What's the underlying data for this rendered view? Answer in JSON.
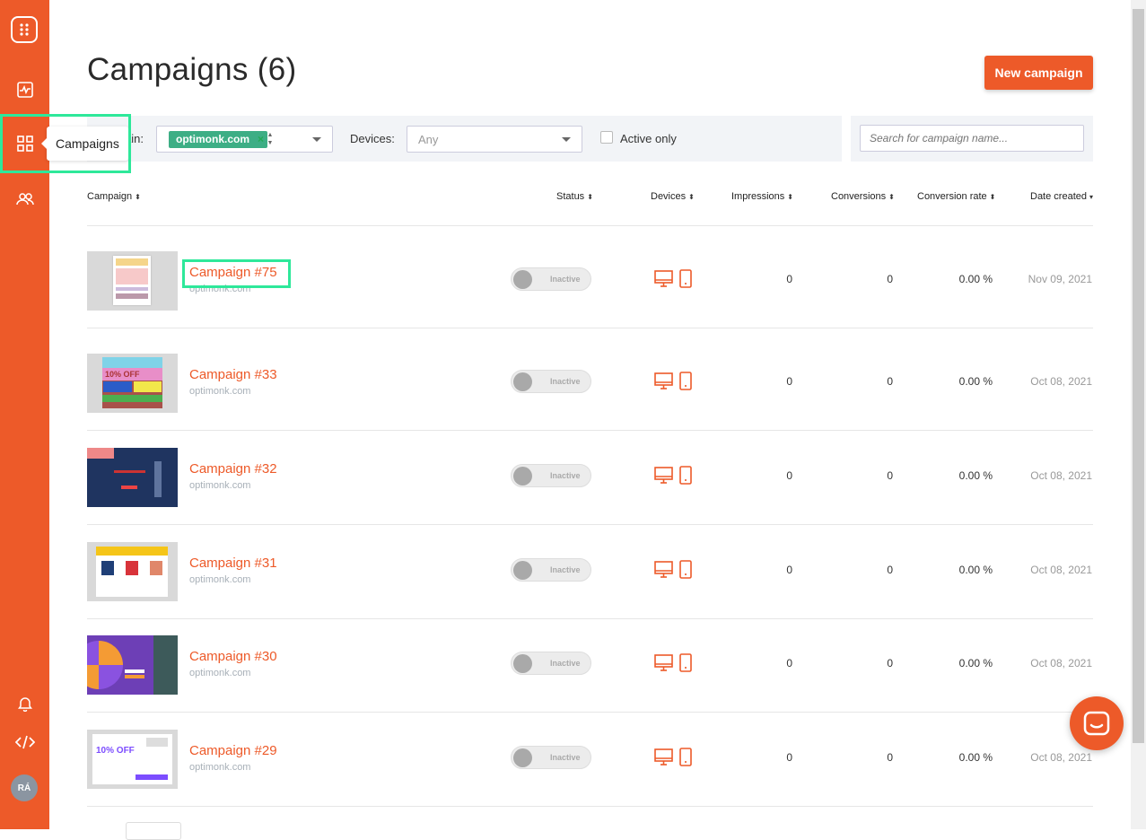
{
  "sidebar": {
    "tooltip": "Campaigns",
    "avatar_initials": "RÁ",
    "icons": [
      "logo-icon",
      "analytics-icon",
      "campaigns-icon",
      "users-icon",
      "bell-icon",
      "code-icon"
    ]
  },
  "header": {
    "title": "Campaigns (6)",
    "new_button": "New campaign"
  },
  "filters": {
    "domain_label": "ain:",
    "domain_chip": "optimonk.com",
    "devices_label": "Devices:",
    "devices_value": "Any",
    "active_only_label": "Active only",
    "search_placeholder": "Search for campaign name..."
  },
  "table": {
    "columns": {
      "campaign": "Campaign",
      "status": "Status",
      "devices": "Devices",
      "impressions": "Impressions",
      "conversions": "Conversions",
      "rate": "Conversion rate",
      "date": "Date created"
    },
    "rows": [
      {
        "name": "Campaign #75",
        "domain": "optimonk.com",
        "status": "Inactive",
        "impressions": "0",
        "conversions": "0",
        "rate": "0.00 %",
        "date": "Nov 09, 2021"
      },
      {
        "name": "Campaign #33",
        "domain": "optimonk.com",
        "status": "Inactive",
        "impressions": "0",
        "conversions": "0",
        "rate": "0.00 %",
        "date": "Oct 08, 2021"
      },
      {
        "name": "Campaign #32",
        "domain": "optimonk.com",
        "status": "Inactive",
        "impressions": "0",
        "conversions": "0",
        "rate": "0.00 %",
        "date": "Oct 08, 2021"
      },
      {
        "name": "Campaign #31",
        "domain": "optimonk.com",
        "status": "Inactive",
        "impressions": "0",
        "conversions": "0",
        "rate": "0.00 %",
        "date": "Oct 08, 2021"
      },
      {
        "name": "Campaign #30",
        "domain": "optimonk.com",
        "status": "Inactive",
        "impressions": "0",
        "conversions": "0",
        "rate": "0.00 %",
        "date": "Oct 08, 2021"
      },
      {
        "name": "Campaign #29",
        "domain": "optimonk.com",
        "status": "Inactive",
        "impressions": "0",
        "conversions": "0",
        "rate": "0.00 %",
        "date": "Oct 08, 2021"
      }
    ]
  },
  "thumbnails": {
    "t33_text": "10% OFF",
    "t29_text": "10% OFF"
  },
  "colors": {
    "brand": "#ed5a29",
    "chip": "#3dae85",
    "highlight": "#2ee89a"
  }
}
